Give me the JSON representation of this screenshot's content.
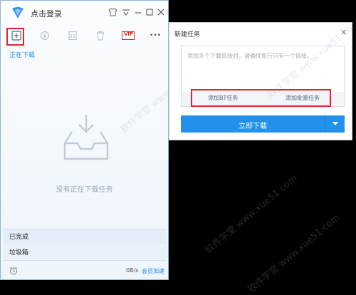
{
  "main_window": {
    "login_label": "点击登录",
    "tab_downloading": "正在下载",
    "empty_message": "没有正在下载任务",
    "sidebar": [
      {
        "label": "已完成"
      },
      {
        "label": "垃圾箱"
      }
    ],
    "status": {
      "speed": "0B/s",
      "vip_accel": "会员加速"
    },
    "toolbar_icons": [
      "add-task-icon",
      "start-icon",
      "pause-icon",
      "delete-icon",
      "vip-icon",
      "more-icon"
    ],
    "vip_badge": "VIP",
    "more_label": "•••"
  },
  "new_task_dialog": {
    "title": "新建任务",
    "close_glyph": "✕",
    "url_placeholder": "添加多个下载链接时，请确保每行只有一个链接。",
    "add_bt_label": "添加BT任务",
    "add_batch_label": "添加批量任务",
    "download_now_label": "立即下载"
  },
  "watermark": "软件学堂 www.xue51.com",
  "colors": {
    "accent": "#2390ec",
    "highlight_red": "#e0252b"
  }
}
